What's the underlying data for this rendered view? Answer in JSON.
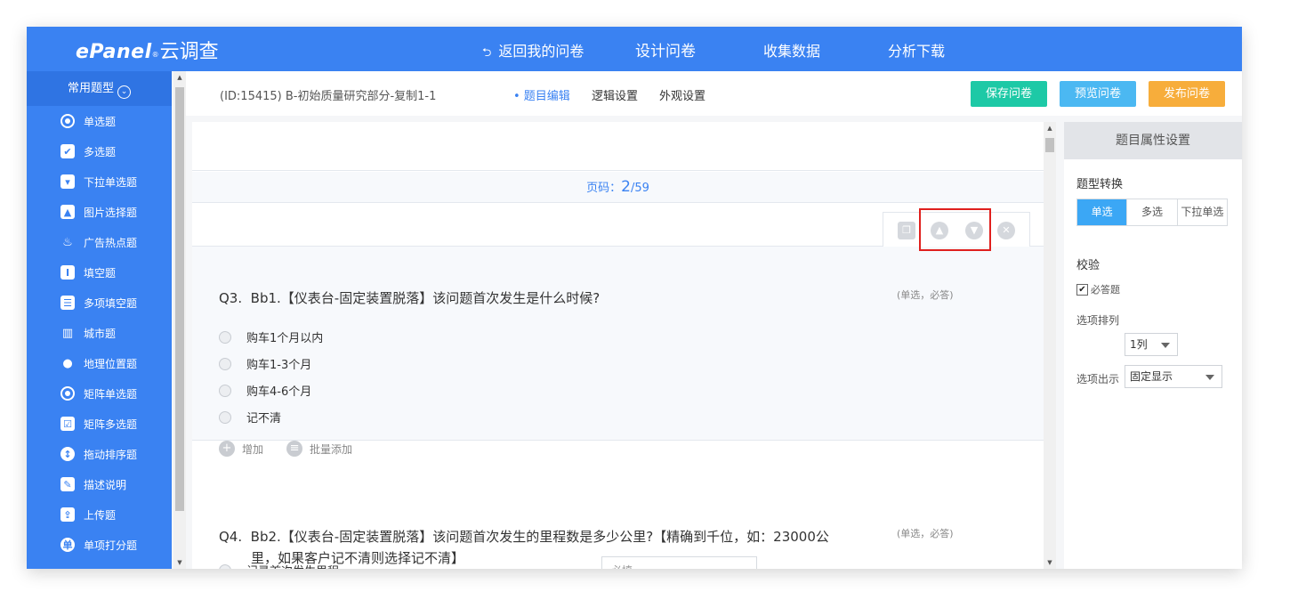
{
  "logo": {
    "brand": "ePanel",
    "reg": "®",
    "name": "云调查"
  },
  "nav": {
    "back": "返回我的问卷",
    "items": [
      "设计问卷",
      "收集数据",
      "分析下载"
    ]
  },
  "sidebar": {
    "header": "常用题型",
    "items": [
      {
        "label": "单选题",
        "icon": "radio-icon"
      },
      {
        "label": "多选题",
        "icon": "checkbox-icon"
      },
      {
        "label": "下拉单选题",
        "icon": "dropdown-icon"
      },
      {
        "label": "图片选择题",
        "icon": "image-icon"
      },
      {
        "label": "广告热点题",
        "icon": "flame-icon"
      },
      {
        "label": "填空题",
        "icon": "text-cursor-icon"
      },
      {
        "label": "多项填空题",
        "icon": "list-icon"
      },
      {
        "label": "城市题",
        "icon": "building-icon"
      },
      {
        "label": "地理位置题",
        "icon": "location-pin-icon"
      },
      {
        "label": "矩阵单选题",
        "icon": "matrix-radio-icon"
      },
      {
        "label": "矩阵多选题",
        "icon": "matrix-checkbox-icon"
      },
      {
        "label": "拖动排序题",
        "icon": "sort-icon"
      },
      {
        "label": "描述说明",
        "icon": "pencil-icon"
      },
      {
        "label": "上传题",
        "icon": "upload-icon"
      },
      {
        "label": "单项打分题",
        "icon": "score-icon"
      }
    ]
  },
  "subbar": {
    "title": "(ID:15415)  B-初始质量研究部分-复制1-1",
    "tabs": [
      "• 题目编辑",
      "逻辑设置",
      "外观设置"
    ],
    "buttons": {
      "save": "保存问卷",
      "preview": "预览问卷",
      "publish": "发布问卷"
    }
  },
  "page": {
    "prefix": "页码：",
    "current": "2",
    "total": "/59"
  },
  "q3": {
    "number": "Q3.",
    "text": "Bb1.【仪表台-固定装置脱落】该问题首次发生是什么时候?",
    "tag": "(单选，必答)",
    "options": [
      "购车1个月以内",
      "购车1-3个月",
      "购车4-6个月",
      "记不清"
    ],
    "add": "增加",
    "batch_add": "批量添加"
  },
  "q4": {
    "number": "Q4.",
    "line1": "Bb2.【仪表台-固定装置脱落】该问题首次发生的里程数是多少公里?【精确到千位，如：23000公",
    "line2": "里，如果客户记不清则选择记不清】",
    "tag": "(单选，必答)",
    "option1": "记录首次发生里程",
    "input_placeholder": "必填"
  },
  "rpanel": {
    "title": "题目属性设置",
    "type_switch_label": "题型转换",
    "type_options": [
      "单选",
      "多选",
      "下拉单选"
    ],
    "validate_label": "校验",
    "required_label": "必答题",
    "arrange_label": "选项排列",
    "arrange_value": "1列",
    "display_label": "选项出示",
    "display_value": "固定显示"
  },
  "colors": {
    "primary": "#3a82f2",
    "save": "#1dc9a6",
    "preview": "#4bb8f2",
    "publish": "#f7ad3b",
    "highlight": "#e0201e"
  }
}
